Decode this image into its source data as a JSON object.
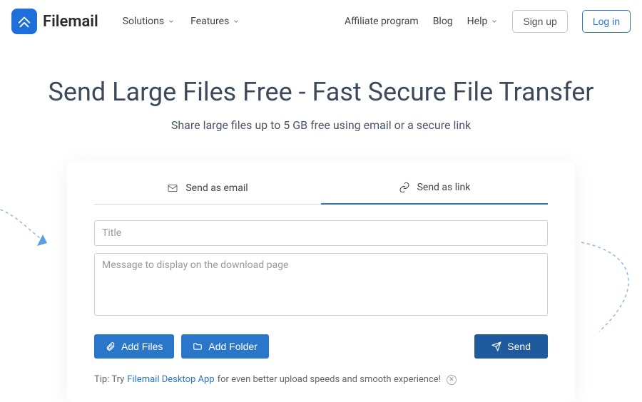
{
  "header": {
    "brand": "Filemail",
    "nav_left": {
      "solutions": "Solutions",
      "features": "Features"
    },
    "nav_right": {
      "affiliate": "Affiliate program",
      "blog": "Blog",
      "help": "Help",
      "signup": "Sign up",
      "login": "Log in"
    }
  },
  "hero": {
    "title": "Send Large Files Free - Fast Secure File Transfer",
    "subtitle": "Share large files up to 5 GB free using email or a secure link"
  },
  "tabs": {
    "email": "Send as email",
    "link": "Send as link"
  },
  "form": {
    "title_placeholder": "Title",
    "message_placeholder": "Message to display on the download page"
  },
  "actions": {
    "add_files": "Add Files",
    "add_folder": "Add Folder",
    "send": "Send"
  },
  "tip": {
    "prefix": "Tip: Try ",
    "link": "Filemail Desktop App",
    "suffix": " for even better upload speeds and smooth experience!"
  }
}
